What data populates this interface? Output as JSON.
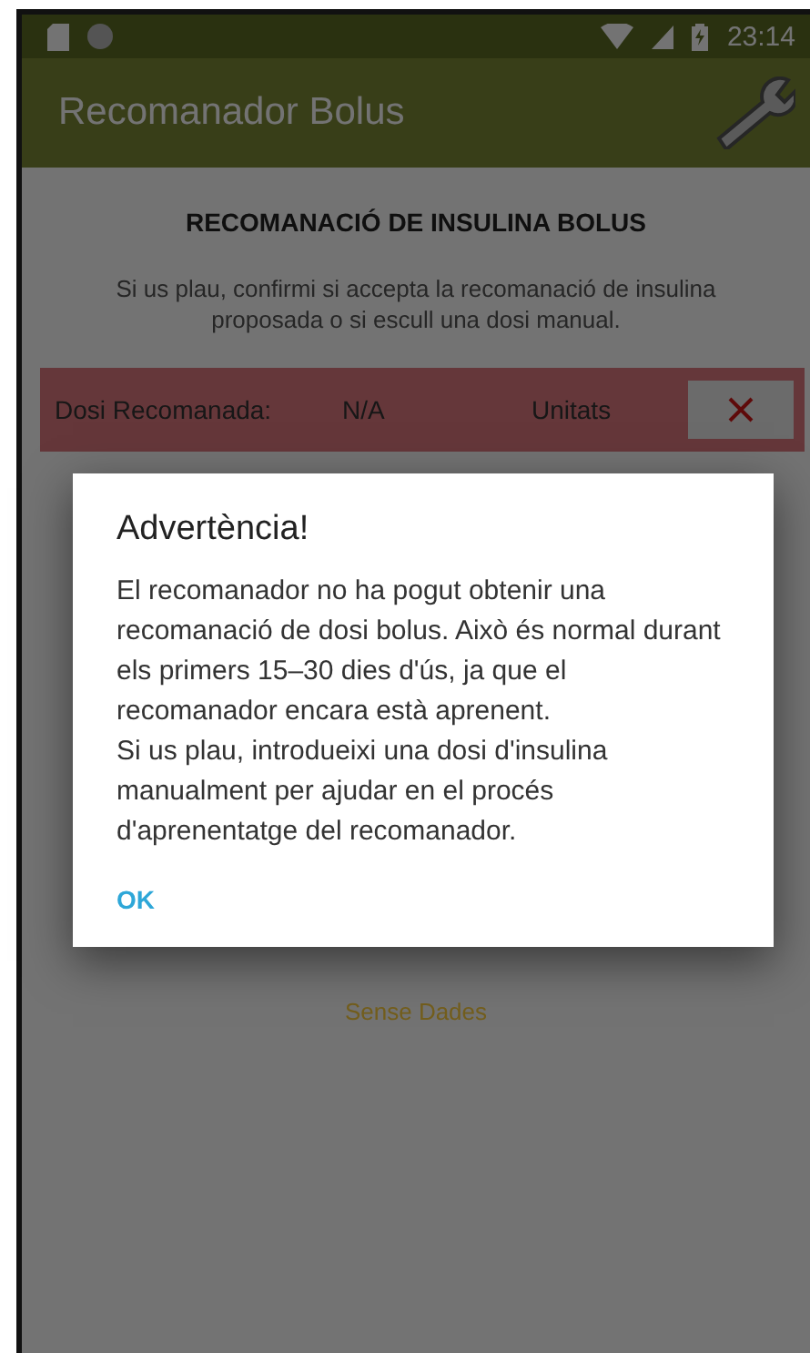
{
  "status_bar": {
    "time": "23:14"
  },
  "app_bar": {
    "title": "Recomanador Bolus"
  },
  "heading": "RECOMANACIÓ DE INSULINA BOLUS",
  "instructions": "Si us plau, confirmi si accepta la recomanació de insulina proposada o si escull una dosi manual.",
  "dose_row": {
    "label": "Dosi Recomanada:",
    "value": "N/A",
    "unit": "Unitats"
  },
  "no_data": "Sense Dades",
  "dialog": {
    "title": "Advertència!",
    "message": "El recomanador no ha pogut obtenir una recomanació de dosi bolus. Això és normal durant els primers 15–30 dies d'ús, ja que el recomanador encara està aprenent.\nSi us plau, introdueixi una dosi d'insulina manualment per ajudar en el procés d'aprenentatge del recomanador.",
    "buttons": [
      "OK"
    ]
  }
}
